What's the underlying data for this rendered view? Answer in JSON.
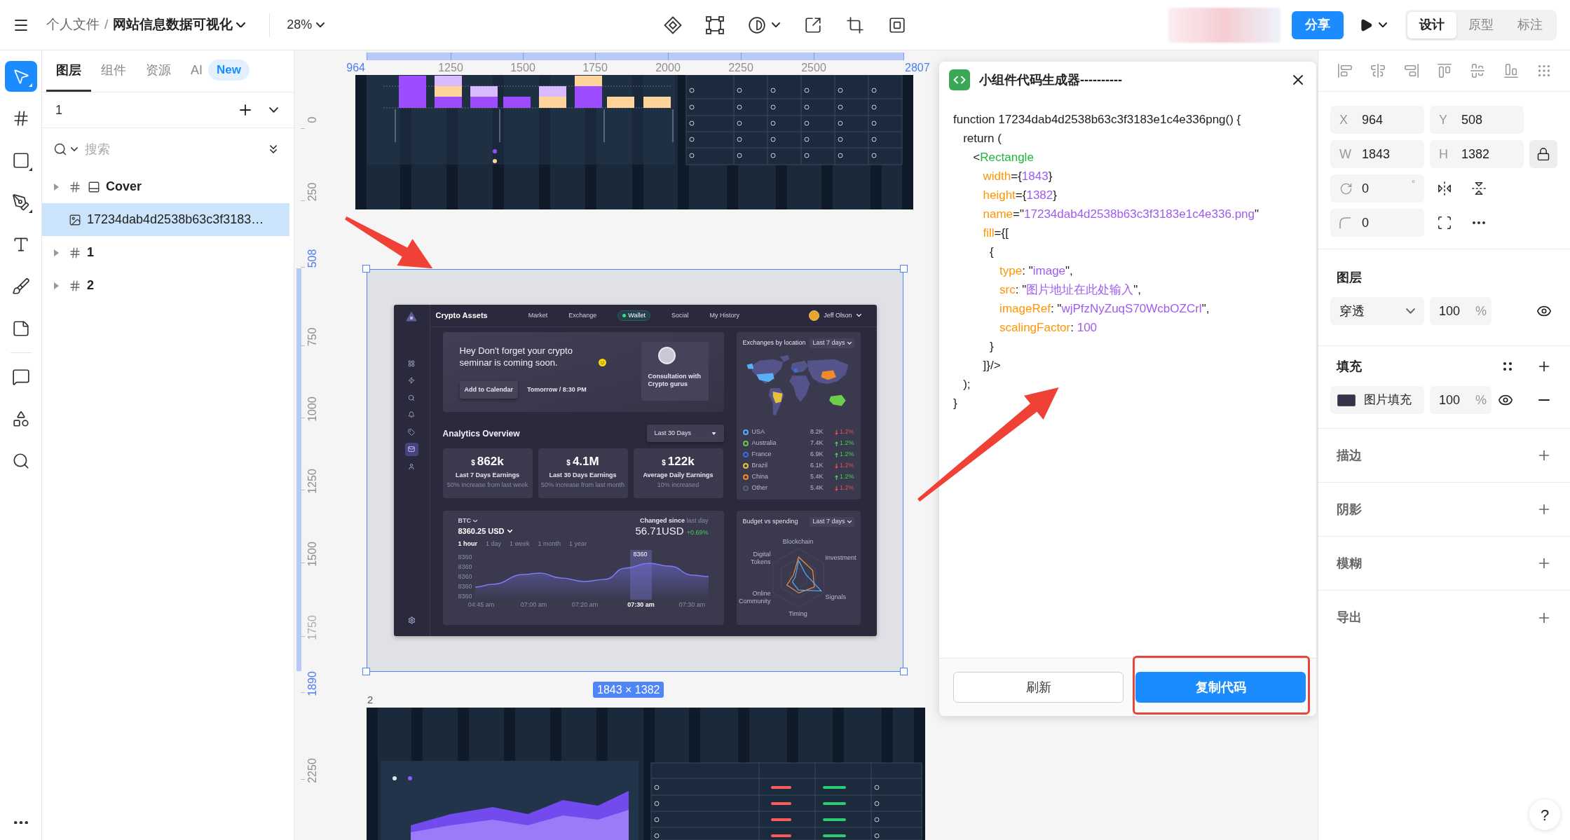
{
  "top_bar": {
    "breadcrumb_parent": "个人文件",
    "breadcrumb_separator": "/",
    "file_name": "网站信息数据可视化",
    "zoom": "28%",
    "share_button": "分享",
    "modes": [
      {
        "label": "设计",
        "selected": true
      },
      {
        "label": "原型",
        "selected": false
      },
      {
        "label": "标注",
        "selected": false
      }
    ]
  },
  "tools": [
    {
      "kind": "select",
      "selected": true
    },
    {
      "kind": "frame",
      "selected": false
    },
    {
      "kind": "rectangle",
      "selected": false
    },
    {
      "kind": "pen",
      "selected": false
    },
    {
      "kind": "text",
      "selected": false
    },
    {
      "kind": "pencil",
      "selected": false
    },
    {
      "kind": "slice",
      "selected": false
    },
    {
      "kind": "comment",
      "selected": false
    },
    {
      "kind": "plugins",
      "selected": false
    },
    {
      "kind": "search",
      "selected": false
    }
  ],
  "layers_panel": {
    "tabs": [
      {
        "label": "图层",
        "selected": true
      },
      {
        "label": "组件",
        "selected": false
      },
      {
        "label": "资源",
        "selected": false
      },
      {
        "label": "AI",
        "selected": false,
        "badge": "New"
      }
    ],
    "page": "1",
    "search": {
      "placeholder": "搜索"
    },
    "layers": [
      {
        "kind": "frame",
        "name": "Cover",
        "auto_layout": true,
        "expanded": false,
        "selected": false
      },
      {
        "kind": "image",
        "name": "17234dab4d2538b63c3f3183…",
        "selected": true
      },
      {
        "kind": "frame",
        "name": "1",
        "auto_layout": false,
        "expanded": false,
        "selected": false
      },
      {
        "kind": "frame",
        "name": "2",
        "auto_layout": false,
        "expanded": false,
        "selected": false
      }
    ]
  },
  "canvas": {
    "ruler_top": [
      {
        "label": "964",
        "kind": "bound"
      },
      {
        "label": "1250",
        "kind": "tick"
      },
      {
        "label": "1500",
        "kind": "tick"
      },
      {
        "label": "1750",
        "kind": "tick"
      },
      {
        "label": "2000",
        "kind": "tick"
      },
      {
        "label": "2250",
        "kind": "tick"
      },
      {
        "label": "2500",
        "kind": "tick"
      },
      {
        "label": "2807",
        "kind": "bound"
      }
    ],
    "ruler_left": [
      {
        "label": "0",
        "kind": "tick"
      },
      {
        "label": "250",
        "kind": "tick"
      },
      {
        "label": "508",
        "kind": "bound"
      },
      {
        "label": "750",
        "kind": "tick"
      },
      {
        "label": "1000",
        "kind": "tick"
      },
      {
        "label": "1250",
        "kind": "tick"
      },
      {
        "label": "1500",
        "kind": "tick"
      },
      {
        "label": "1750",
        "kind": "faded"
      },
      {
        "label": "1890",
        "kind": "bound"
      },
      {
        "label": "2250",
        "kind": "tick"
      }
    ],
    "selection_size": "1843 × 1382",
    "frame_label": "2",
    "annotations": [
      {
        "kind": "arrow"
      },
      {
        "kind": "arrow"
      }
    ]
  },
  "dashboard": {
    "title": "Crypto Assets",
    "nav": [
      {
        "label": "Market",
        "selected": false
      },
      {
        "label": "Exchange",
        "selected": false
      },
      {
        "label": "Wallet",
        "selected": true
      },
      {
        "label": "Social",
        "selected": false
      },
      {
        "label": "My History",
        "selected": false
      }
    ],
    "user_name": "Jeff Olson",
    "sidebar": [
      {
        "kind": "grid",
        "selected": false
      },
      {
        "kind": "bolt",
        "selected": false
      },
      {
        "kind": "search",
        "selected": false
      },
      {
        "kind": "bell",
        "selected": false
      },
      {
        "kind": "tag",
        "selected": false
      },
      {
        "kind": "mail",
        "selected": true
      },
      {
        "kind": "user",
        "selected": false
      }
    ],
    "banner": {
      "message": "Hey Don't forget your crypto seminar is coming soon.",
      "button": "Add to Calendar",
      "time": "Tomorrow / 8:30 PM",
      "consultation": "Consultation with Crypto gurus"
    },
    "analytics": {
      "title": "Analytics Overview",
      "range": "Last 30 Days",
      "stats": [
        {
          "currency": "$",
          "value": "862k",
          "label": "Last 7 Days Earnings",
          "note": "50% Increase from last week"
        },
        {
          "currency": "$",
          "value": "4.1M",
          "label": "Last 30 Days Earnings",
          "note": "50% increase from last month"
        },
        {
          "currency": "$",
          "value": "122k",
          "label": "Average Daily Earnings",
          "note": "10% increased"
        }
      ]
    },
    "price": {
      "coin": "BTC",
      "amount": "8360.25 USD",
      "changed": "**Changed since** last day",
      "value": "56.71USD",
      "change": "+0.69%",
      "ranges": [
        {
          "label": "1 hour",
          "selected": true
        },
        {
          "label": "1 day",
          "selected": false
        },
        {
          "label": "1 week",
          "selected": false
        },
        {
          "label": "1 month",
          "selected": false
        },
        {
          "label": "1 year",
          "selected": false
        }
      ],
      "yticks": [
        "8360",
        "8360",
        "8360",
        "8360",
        "8360"
      ],
      "xticks": [
        "04:45 am",
        "07:00 am",
        "07:20 am",
        "07:30 am",
        "07:30 am"
      ],
      "marker": "8360"
    },
    "exchanges": {
      "title": "Exchanges by location",
      "range": "Last 7 days",
      "rows": [
        {
          "country": "USA",
          "value": "8.2K",
          "change": "1.2%",
          "rising": false,
          "color": "#5aa9f0"
        },
        {
          "country": "Australia",
          "value": "7.4K",
          "change": "1.2%",
          "rising": true,
          "color": "#6cc24a"
        },
        {
          "country": "France",
          "value": "6.9K",
          "change": "1.2%",
          "rising": true,
          "color": "#3a6ee0"
        },
        {
          "country": "Brazil",
          "value": "6.1K",
          "change": "1.2%",
          "rising": false,
          "color": "#e6c13e"
        },
        {
          "country": "China",
          "value": "5.4K",
          "change": "1.2%",
          "rising": true,
          "color": "#f08a2a"
        },
        {
          "country": "Other",
          "value": "5.4K",
          "change": "1.2%",
          "rising": false,
          "color": "#5c5b76"
        }
      ]
    },
    "budget": {
      "title": "Budget vs spending",
      "range": "Last 7 days",
      "axes": [
        "Blockchain",
        "Digital Tokens",
        "Investment",
        "Online Community",
        "Signals",
        "Timing"
      ]
    }
  },
  "code_panel": {
    "title": "小组件代码生成器----------",
    "lines": [
      [
        {
          "kind": "plain",
          "text": "function 17234dab4d2538b63c3f3183e1c4e336png() {"
        }
      ],
      [
        {
          "kind": "plain",
          "text": "   return ("
        }
      ],
      [
        {
          "kind": "plain",
          "text": "      <"
        },
        {
          "kind": "tag",
          "text": "Rectangle"
        }
      ],
      [
        {
          "kind": "attr",
          "text": "         width"
        },
        {
          "kind": "plain",
          "text": "={"
        },
        {
          "kind": "value",
          "text": "1843"
        },
        {
          "kind": "plain",
          "text": "}"
        }
      ],
      [
        {
          "kind": "attr",
          "text": "         height"
        },
        {
          "kind": "plain",
          "text": "={"
        },
        {
          "kind": "value",
          "text": "1382"
        },
        {
          "kind": "plain",
          "text": "}"
        }
      ],
      [
        {
          "kind": "attr",
          "text": "         name"
        },
        {
          "kind": "plain",
          "text": "=\""
        },
        {
          "kind": "value",
          "text": "17234dab4d2538b63c3f3183e1c4e336.png"
        },
        {
          "kind": "plain",
          "text": "\""
        }
      ],
      [
        {
          "kind": "attr",
          "text": "         fill"
        },
        {
          "kind": "plain",
          "text": "={["
        }
      ],
      [
        {
          "kind": "plain",
          "text": "           {"
        }
      ],
      [
        {
          "kind": "attr",
          "text": "              type"
        },
        {
          "kind": "plain",
          "text": ": \""
        },
        {
          "kind": "value",
          "text": "image"
        },
        {
          "kind": "plain",
          "text": "\","
        }
      ],
      [
        {
          "kind": "attr",
          "text": "              src"
        },
        {
          "kind": "plain",
          "text": ": \""
        },
        {
          "kind": "value",
          "text": "图片地址在此处输入"
        },
        {
          "kind": "plain",
          "text": "\","
        }
      ],
      [
        {
          "kind": "attr",
          "text": "              imageRef"
        },
        {
          "kind": "plain",
          "text": ": \""
        },
        {
          "kind": "value",
          "text": "wjPfzNyZuqS70WcbOZCrl"
        },
        {
          "kind": "plain",
          "text": "\","
        }
      ],
      [
        {
          "kind": "attr",
          "text": "              scalingFactor"
        },
        {
          "kind": "plain",
          "text": ": "
        },
        {
          "kind": "value",
          "text": "100"
        }
      ],
      [
        {
          "kind": "plain",
          "text": "           }"
        }
      ],
      [
        {
          "kind": "plain",
          "text": "         ]}/>"
        }
      ],
      [
        {
          "kind": "plain",
          "text": "   );"
        }
      ],
      [
        {
          "kind": "plain",
          "text": "}"
        }
      ]
    ],
    "buttons": [
      {
        "label": "刷新",
        "kind": "secondary",
        "highlighted": false
      },
      {
        "label": "复制代码",
        "kind": "primary",
        "highlighted": true
      }
    ]
  },
  "properties": {
    "position": [
      {
        "label": "X",
        "value": "964"
      },
      {
        "label": "Y",
        "value": "508"
      }
    ],
    "size": [
      {
        "label": "W",
        "value": "1843"
      },
      {
        "label": "H",
        "value": "1382"
      }
    ],
    "ratio_locked": true,
    "rotation": {
      "value": "0",
      "unit": "°"
    },
    "corner_radius": "0",
    "layer": {
      "title": "图层",
      "blend": "穿透",
      "opacity": "100",
      "unit": "%",
      "visible": true
    },
    "fill": {
      "title": "填充",
      "items": [
        {
          "label": "图片填充",
          "opacity": "100",
          "unit": "%",
          "visible": true
        }
      ]
    },
    "sections": [
      {
        "title": "描边"
      },
      {
        "title": "阴影"
      },
      {
        "title": "模糊"
      },
      {
        "title": "导出"
      }
    ],
    "help": "?"
  }
}
